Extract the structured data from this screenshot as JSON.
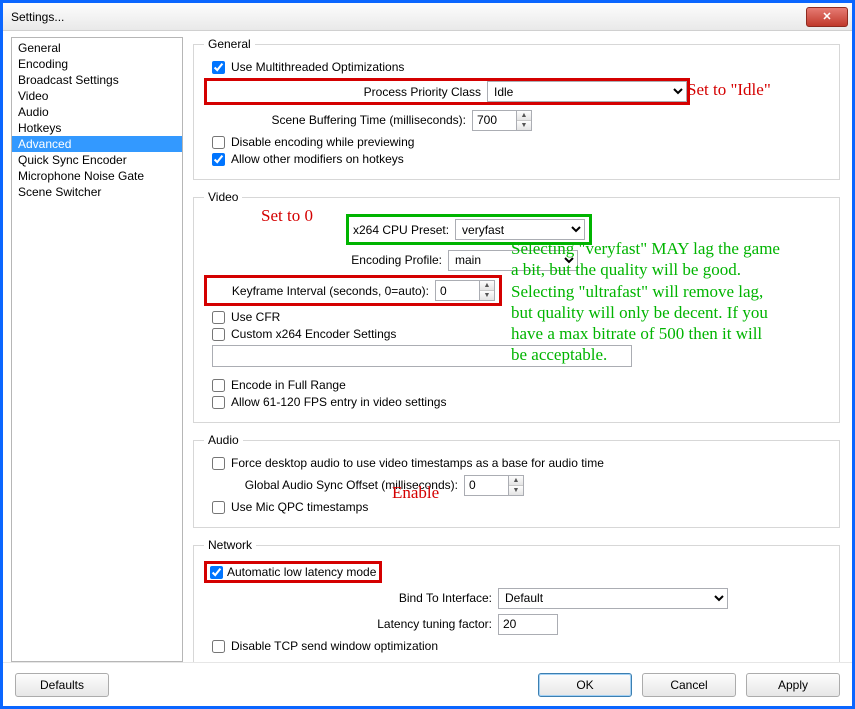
{
  "window": {
    "title": "Settings..."
  },
  "sidebar": {
    "items": [
      "General",
      "Encoding",
      "Broadcast Settings",
      "Video",
      "Audio",
      "Hotkeys",
      "Advanced",
      "Quick Sync Encoder",
      "Microphone Noise Gate",
      "Scene Switcher"
    ],
    "selected_index": 6
  },
  "groups": {
    "general": {
      "legend": "General",
      "multithread": {
        "label": "Use Multithreaded Optimizations",
        "checked": true
      },
      "priority": {
        "label": "Process Priority Class",
        "value": "Idle",
        "options": [
          "Idle"
        ]
      },
      "buffering": {
        "label": "Scene Buffering Time (milliseconds):",
        "value": "700"
      },
      "disable_preview": {
        "label": "Disable encoding while previewing",
        "checked": false
      },
      "allow_modifiers": {
        "label": "Allow other modifiers on hotkeys",
        "checked": true
      }
    },
    "video": {
      "legend": "Video",
      "preset": {
        "label": "x264 CPU Preset:",
        "value": "veryfast",
        "options": [
          "veryfast"
        ]
      },
      "profile": {
        "label": "Encoding Profile:",
        "value": "main",
        "options": [
          "main"
        ]
      },
      "keyframe": {
        "label": "Keyframe Interval (seconds, 0=auto):",
        "value": "0"
      },
      "cfr": {
        "label": "Use CFR",
        "checked": false
      },
      "custom_x264": {
        "label": "Custom x264 Encoder Settings",
        "checked": false,
        "value": ""
      },
      "full_range": {
        "label": "Encode in Full Range",
        "checked": false
      },
      "allow_fps": {
        "label": "Allow 61-120 FPS entry in video settings",
        "checked": false
      }
    },
    "audio": {
      "legend": "Audio",
      "force_timestamps": {
        "label": "Force desktop audio to use video timestamps as a base for audio time",
        "checked": false
      },
      "sync_offset": {
        "label": "Global Audio Sync Offset (milliseconds):",
        "value": "0"
      },
      "mic_qpc": {
        "label": "Use Mic QPC timestamps",
        "checked": false
      }
    },
    "network": {
      "legend": "Network",
      "low_latency": {
        "label": "Automatic low latency mode",
        "checked": true
      },
      "bind": {
        "label": "Bind To Interface:",
        "value": "Default",
        "options": [
          "Default"
        ]
      },
      "latency_factor": {
        "label": "Latency tuning factor:",
        "value": "20"
      },
      "disable_tcp": {
        "label": "Disable TCP send window optimization",
        "checked": false
      }
    }
  },
  "annotations": {
    "set_idle": "Set to \"Idle\"",
    "set_zero": "Set to 0",
    "veryfast_note": "Selecting \"veryfast\" MAY lag the game\na bit, but the quality will be good.\nSelecting \"ultrafast\" will remove lag,\nbut quality will only be decent. If you\nhave a max bitrate of 500 then it will\nbe acceptable.",
    "enable": "Enable"
  },
  "footer": {
    "defaults": "Defaults",
    "ok": "OK",
    "cancel": "Cancel",
    "apply": "Apply"
  },
  "colors": {
    "highlight_red": "#d40000",
    "highlight_green": "#00b400",
    "selection": "#3399ff"
  }
}
